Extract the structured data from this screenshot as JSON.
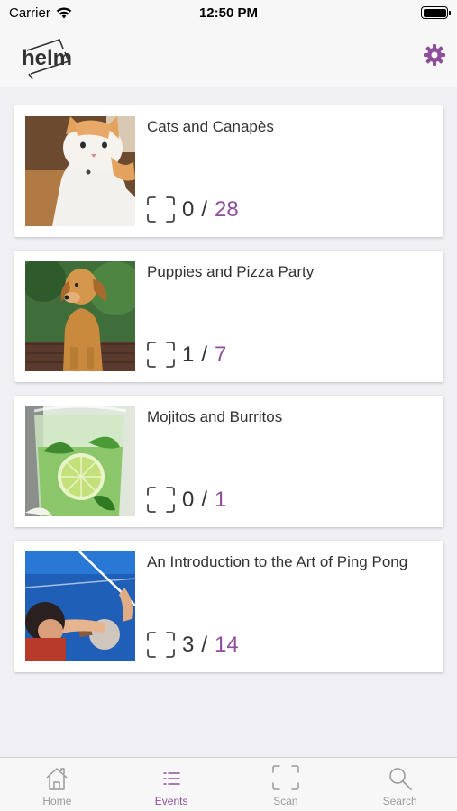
{
  "status_bar": {
    "carrier": "Carrier",
    "time": "12:50 PM"
  },
  "header": {
    "logo_text": "helm",
    "accent_color": "#8e4e99"
  },
  "events": [
    {
      "title": "Cats and Canapès",
      "scanned": "0",
      "separator": "/",
      "total": "28",
      "image": "cat-photo"
    },
    {
      "title": "Puppies and Pizza Party",
      "scanned": "1",
      "separator": "/",
      "total": "7",
      "image": "puppy-photo"
    },
    {
      "title": "Mojitos and Burritos",
      "scanned": "0",
      "separator": "/",
      "total": "1",
      "image": "mojito-photo"
    },
    {
      "title": "An Introduction to the Art of Ping Pong",
      "scanned": "3",
      "separator": "/",
      "total": "14",
      "image": "ping-pong-photo"
    }
  ],
  "tabs": [
    {
      "label": "Home",
      "icon": "home-icon",
      "active": false
    },
    {
      "label": "Events",
      "icon": "list-icon",
      "active": true
    },
    {
      "label": "Scan",
      "icon": "scan-icon",
      "active": false
    },
    {
      "label": "Search",
      "icon": "search-icon",
      "active": false
    }
  ]
}
